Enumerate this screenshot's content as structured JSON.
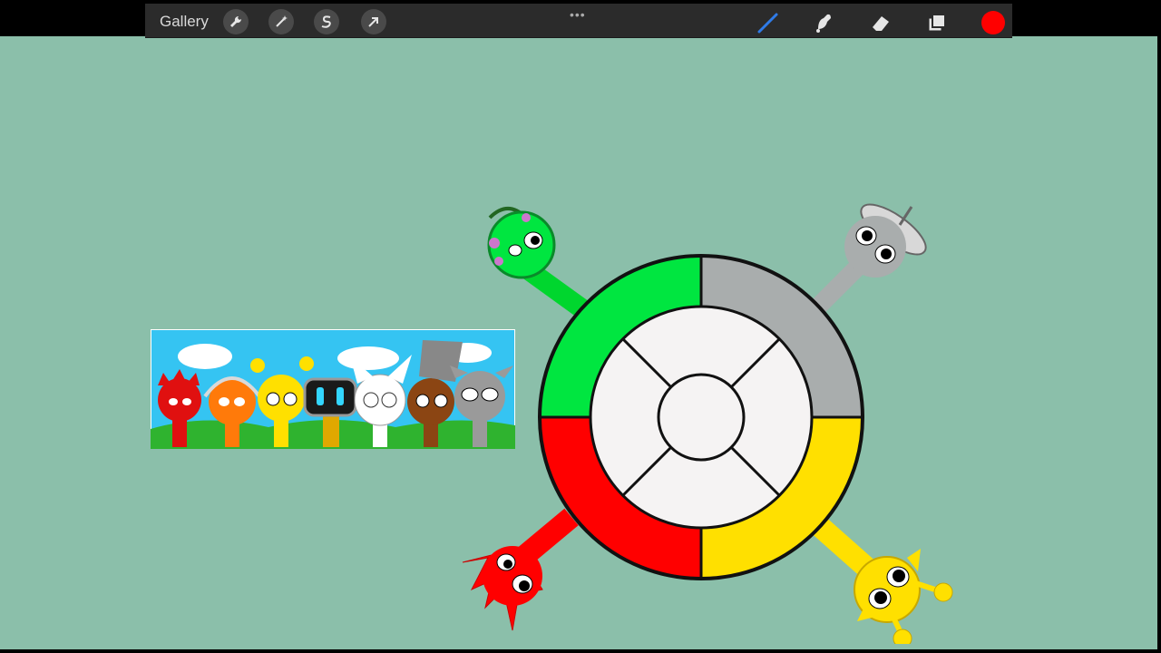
{
  "toolbar": {
    "gallery_label": "Gallery",
    "left_tools": [
      "wrench-icon",
      "magic-wand-icon",
      "selection-s-icon",
      "transform-arrow-icon"
    ],
    "grab_handle": "•••",
    "right_tools": [
      "brush-icon",
      "smudge-icon",
      "eraser-icon",
      "layers-icon"
    ],
    "current_color": "#ff0000"
  },
  "canvas": {
    "background": "#8bbfaa",
    "thumbnail": {
      "characters": [
        "red",
        "orange",
        "yellow",
        "robot",
        "white",
        "brown",
        "gray"
      ],
      "sky_color": "#35c4f2",
      "grass_color": "#2fb32f"
    },
    "wheel": {
      "segments": [
        {
          "name": "green",
          "color": "#00e640"
        },
        {
          "name": "gray",
          "color": "#a9adad"
        },
        {
          "name": "yellow",
          "color": "#ffe000"
        },
        {
          "name": "red",
          "color": "#ff0000"
        }
      ],
      "inner_color": "#f5f3f3"
    }
  }
}
